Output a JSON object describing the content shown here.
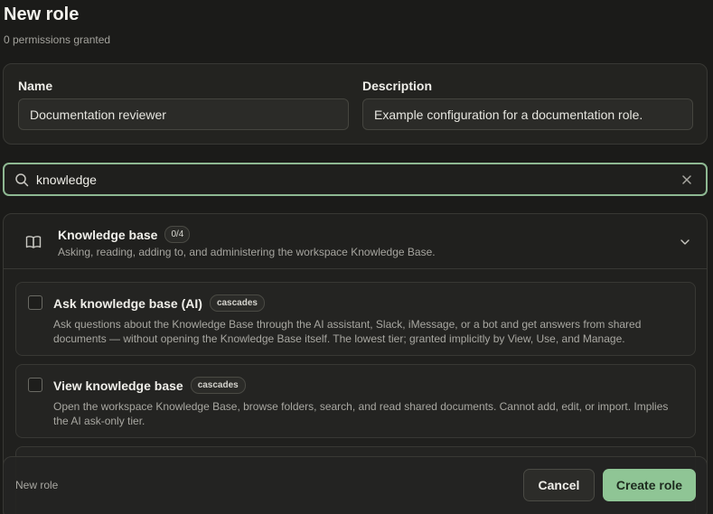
{
  "header": {
    "title": "New role",
    "subtitle": "0 permissions granted"
  },
  "details": {
    "name_label": "Name",
    "name_value": "Documentation reviewer",
    "description_label": "Description",
    "description_value": "Example configuration for a documentation role."
  },
  "search": {
    "value": "knowledge",
    "icon": "search-icon",
    "clear_icon": "close-icon"
  },
  "group": {
    "icon": "book-icon",
    "title": "Knowledge base",
    "count": "0/4",
    "description": "Asking, reading, adding to, and administering the workspace Knowledge Base.",
    "expanded": true,
    "permissions": [
      {
        "title": "Ask knowledge base (AI)",
        "tag": "cascades",
        "checked": false,
        "description": "Ask questions about the Knowledge Base through the AI assistant, Slack, iMessage, or a bot and get answers from shared documents — without opening the Knowledge Base itself. The lowest tier; granted implicitly by View, Use, and Manage."
      },
      {
        "title": "View knowledge base",
        "tag": "cascades",
        "checked": false,
        "description": "Open the workspace Knowledge Base, browse folders, search, and read shared documents. Cannot add, edit, or import. Implies the AI ask-only tier."
      }
    ]
  },
  "footer": {
    "label": "New role",
    "cancel_label": "Cancel",
    "create_label": "Create role"
  },
  "colors": {
    "background": "#1b1b19",
    "accent": "#8fc595",
    "focus_border": "#8eb892"
  }
}
